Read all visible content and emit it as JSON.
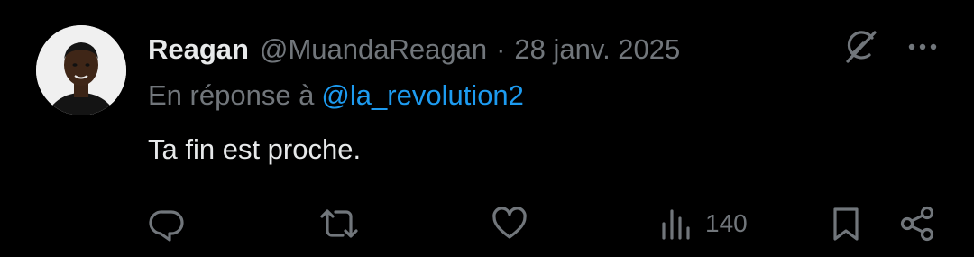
{
  "tweet": {
    "author": {
      "display_name": "Reagan",
      "handle": "@MuandaReagan"
    },
    "separator": "·",
    "date": "28 janv. 2025",
    "reply_prefix": "En réponse à",
    "reply_to": "@la_revolution2",
    "text": "Ta fin est proche.",
    "header_icons": [
      "grok-icon",
      "more-icon"
    ]
  },
  "actions": {
    "reply_icon": "reply-icon",
    "retweet_icon": "retweet-icon",
    "like_icon": "heart-icon",
    "views_icon": "views-icon",
    "views_count": "140",
    "bookmark_icon": "bookmark-icon",
    "share_icon": "share-icon"
  },
  "colors": {
    "background": "#000000",
    "primary_text": "#e7e9ea",
    "secondary_text": "#71767b",
    "link": "#1d9bf0"
  }
}
